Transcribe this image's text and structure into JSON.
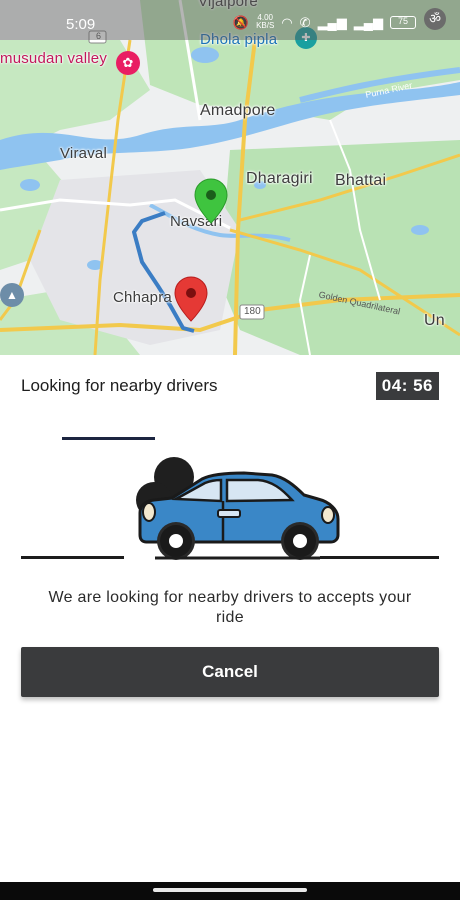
{
  "status_bar": {
    "time": "5:09",
    "network_speed_value": "4.00",
    "network_speed_unit": "KB/S",
    "battery": "75"
  },
  "map": {
    "labels": {
      "vijalpore": "Vijalpore",
      "madhusudan_valley": "musudan valley",
      "dhola_pipla": "Dhola pipla",
      "amadpore": "Amadpore",
      "viraval": "Viraval",
      "dharagiri": "Dharagiri",
      "bhattai": "Bhattai",
      "navsari": "Navsari",
      "chhapra": "Chhapra",
      "un": "Un",
      "purna_river": "Purna River",
      "golden_quadrilateral": "Golden Quadrilateral",
      "highway_6": "6",
      "highway_180": "180"
    },
    "colors": {
      "pickup_pin": "#3fc43f",
      "drop_pin": "#e53935",
      "route": "#3b7dc4",
      "water": "#8fc3f0",
      "green": "#b9e2b4",
      "road": "#f2c94c"
    }
  },
  "sheet": {
    "title": "Looking for nearby drivers",
    "timer": "04: 56",
    "message": "We are looking for nearby drivers to accepts your ride",
    "cancel_label": "Cancel"
  },
  "progress": {
    "value": 0.22
  }
}
